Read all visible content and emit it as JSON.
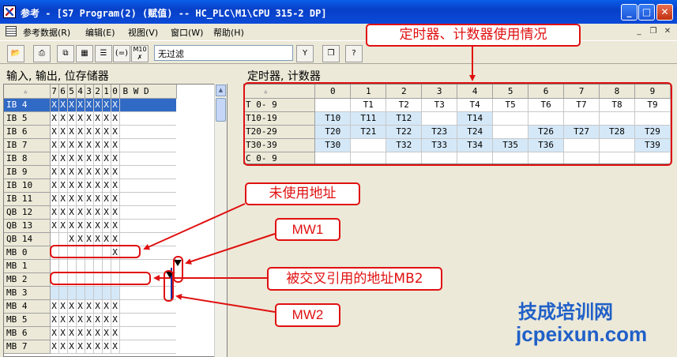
{
  "window": {
    "title": "参考 - [S7 Program(2) (赋值) -- HC_PLC\\M1\\CPU 315-2 DP]"
  },
  "menu": [
    "参考数据(R)",
    "编辑(E)",
    "视图(V)",
    "窗口(W)",
    "帮助(H)"
  ],
  "toolbar": {
    "filter_value": "无过滤",
    "m10_label": "M10"
  },
  "left_panel": {
    "title": "输入, 输出, 位存储器",
    "bit_headers": [
      "7",
      "6",
      "5",
      "4",
      "3",
      "2",
      "1",
      "0"
    ],
    "bwd_header": "B W D",
    "rows": [
      {
        "addr": "IB  4",
        "bits": [
          "X",
          "X",
          "X",
          "X",
          "X",
          "X",
          "X",
          "X"
        ]
      },
      {
        "addr": "IB  5",
        "bits": [
          "X",
          "X",
          "X",
          "X",
          "X",
          "X",
          "X",
          "X"
        ]
      },
      {
        "addr": "IB  6",
        "bits": [
          "X",
          "X",
          "X",
          "X",
          "X",
          "X",
          "X",
          "X"
        ]
      },
      {
        "addr": "IB  7",
        "bits": [
          "X",
          "X",
          "X",
          "X",
          "X",
          "X",
          "X",
          "X"
        ]
      },
      {
        "addr": "IB  8",
        "bits": [
          "X",
          "X",
          "X",
          "X",
          "X",
          "X",
          "X",
          "X"
        ]
      },
      {
        "addr": "IB  9",
        "bits": [
          "X",
          "X",
          "X",
          "X",
          "X",
          "X",
          "X",
          "X"
        ]
      },
      {
        "addr": "IB 10",
        "bits": [
          "X",
          "X",
          "X",
          "X",
          "X",
          "X",
          "X",
          "X"
        ]
      },
      {
        "addr": "IB 11",
        "bits": [
          "X",
          "X",
          "X",
          "X",
          "X",
          "X",
          "X",
          "X"
        ]
      },
      {
        "addr": "QB 12",
        "bits": [
          "X",
          "X",
          "X",
          "X",
          "X",
          "X",
          "X",
          "X"
        ]
      },
      {
        "addr": "QB 13",
        "bits": [
          "X",
          "X",
          "X",
          "X",
          "X",
          "X",
          "X",
          "X"
        ]
      },
      {
        "addr": "QB 14",
        "bits": [
          "",
          "",
          "X",
          "X",
          "X",
          "X",
          "X",
          "X"
        ]
      },
      {
        "addr": "MB  0",
        "bits": [
          "",
          "",
          "",
          "",
          "",
          "",
          "",
          "X"
        ]
      },
      {
        "addr": "MB  1",
        "bits": [
          "",
          "",
          "",
          "",
          "",
          "",
          "",
          ""
        ]
      },
      {
        "addr": "MB  2",
        "bits": [
          "",
          "",
          "",
          "",
          "",
          "",
          "",
          ""
        ]
      },
      {
        "addr": "MB  3",
        "bits": [
          "",
          "",
          "",
          "",
          "",
          "",
          "",
          ""
        ]
      },
      {
        "addr": "MB  4",
        "bits": [
          "X",
          "X",
          "X",
          "X",
          "X",
          "X",
          "X",
          "X"
        ]
      },
      {
        "addr": "MB  5",
        "bits": [
          "X",
          "X",
          "X",
          "X",
          "X",
          "X",
          "X",
          "X"
        ]
      },
      {
        "addr": "MB  6",
        "bits": [
          "X",
          "X",
          "X",
          "X",
          "X",
          "X",
          "X",
          "X"
        ]
      },
      {
        "addr": "MB  7",
        "bits": [
          "X",
          "X",
          "X",
          "X",
          "X",
          "X",
          "X",
          "X"
        ]
      }
    ]
  },
  "right_panel": {
    "title": "定时器, 计数器",
    "col_headers": [
      "0",
      "1",
      "2",
      "3",
      "4",
      "5",
      "6",
      "7",
      "8",
      "9"
    ],
    "rows": [
      {
        "label": "T 0- 9",
        "cells": [
          "",
          "T1",
          "T2",
          "T3",
          "T4",
          "T5",
          "T6",
          "T7",
          "T8",
          "T9"
        ]
      },
      {
        "label": "T10-19",
        "cells": [
          "T10",
          "T11",
          "T12",
          "",
          "T14",
          "",
          "",
          "",
          "",
          ""
        ]
      },
      {
        "label": "T20-29",
        "cells": [
          "T20",
          "T21",
          "T22",
          "T23",
          "T24",
          "",
          "T26",
          "T27",
          "T28",
          "T29"
        ]
      },
      {
        "label": "T30-39",
        "cells": [
          "T30",
          "",
          "T32",
          "T33",
          "T34",
          "T35",
          "T36",
          "",
          "",
          "T39"
        ]
      },
      {
        "label": "C 0- 9",
        "cells": [
          "",
          "",
          "",
          "",
          "",
          "",
          "",
          "",
          "",
          ""
        ]
      }
    ]
  },
  "annotations": {
    "timer_usage": "定时器、计数器使用情况",
    "unused": "未使用地址",
    "mw1": "MW1",
    "mb2": "被交叉引用的地址MB2",
    "mw2": "MW2"
  },
  "watermark": {
    "cn": "技成培训网",
    "url": "jcpeixun.com"
  },
  "colors": {
    "annotation": "#e01010",
    "used_cell": "#d4e8f8",
    "selection": "#316ac5",
    "watermark": "#2060c8"
  }
}
